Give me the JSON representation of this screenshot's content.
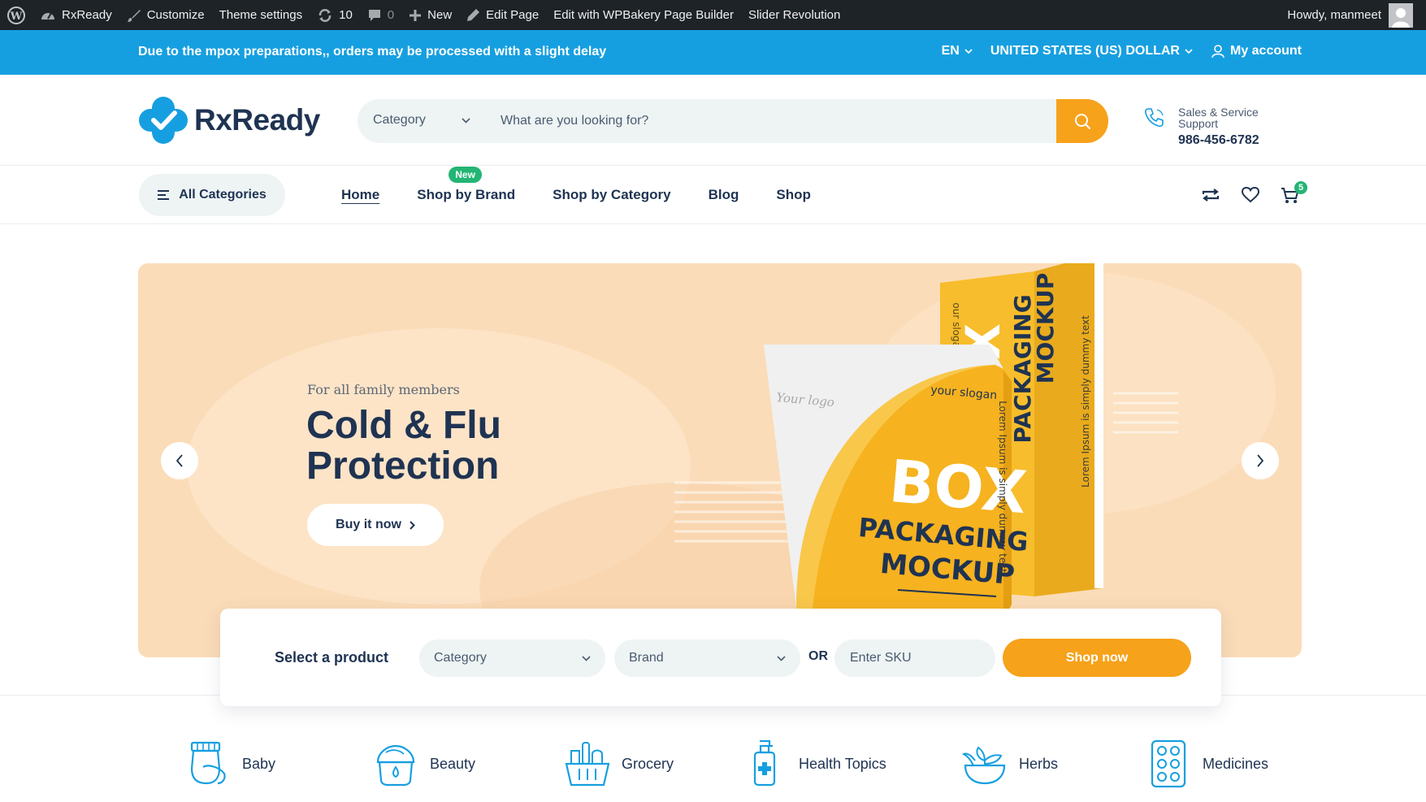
{
  "admin_bar": {
    "site_name": "RxReady",
    "customize": "Customize",
    "theme_settings": "Theme settings",
    "updates_count": "10",
    "comments_count": "0",
    "new": "New",
    "edit_page": "Edit Page",
    "wpbakery": "Edit with WPBakery Page Builder",
    "slider": "Slider Revolution",
    "howdy": "Howdy, manmeet"
  },
  "notice": {
    "text": "Due to the mpox preparations,, orders may be processed with a slight delay",
    "language": "EN",
    "currency": "UNITED STATES (US) DOLLAR",
    "account": "My account"
  },
  "header": {
    "logo_text": "RxReady",
    "search_category": "Category",
    "search_placeholder": "What are you looking for?",
    "support_label": "Sales & Service Support",
    "support_phone": "986-456-6782"
  },
  "nav": {
    "all_categories": "All Categories",
    "items": [
      "Home",
      "Shop by Brand",
      "Shop by Category",
      "Blog",
      "Shop"
    ],
    "badge_new": "New",
    "cart_count": "5"
  },
  "hero": {
    "subtitle": "For all family members",
    "title": "Cold & Flu Protection",
    "button": "Buy it now",
    "box_logo": "Your logo",
    "box_slogan": "your slogan",
    "box_title_1": "BOX",
    "box_title_2": "PACKAGING",
    "box_title_3": "MOCKUP",
    "box_side_text": "Lorem Ipsum is simply dummy text",
    "back_box_title_1": "PACKAGING",
    "back_box_title_2": "MOCKUP",
    "back_box_big": "OX",
    "back_box_slogan": "our slogan",
    "back_box_side": "Lorem Ipsum is simply dummy text"
  },
  "selector": {
    "label": "Select a product",
    "category": "Category",
    "brand": "Brand",
    "or": "OR",
    "sku_placeholder": "Enter SKU",
    "button": "Shop now"
  },
  "categories": [
    "Baby",
    "Beauty",
    "Grocery",
    "Health Topics",
    "Herbs",
    "Medicines"
  ],
  "colors": {
    "admin_bar": "#1d2327",
    "notice": "#169fe0",
    "accent_orange": "#f6a21b",
    "navy": "#1f3352",
    "green": "#23b574",
    "hero_bg": "#fbdcb8"
  }
}
